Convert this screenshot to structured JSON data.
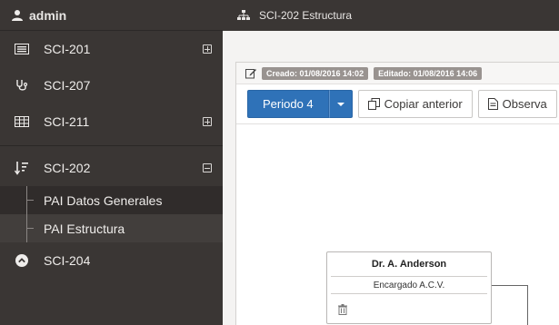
{
  "user": {
    "name": "admin"
  },
  "sidebar": {
    "items": [
      {
        "label": "SCI-201",
        "icon": "list-box-icon",
        "toggle": "plus"
      },
      {
        "label": "SCI-207",
        "icon": "stethoscope-icon",
        "toggle": "none"
      },
      {
        "label": "SCI-211",
        "icon": "table-icon",
        "toggle": "plus"
      },
      {
        "label": "SCI-202",
        "icon": "sort-down-icon",
        "toggle": "minus",
        "children": [
          {
            "label": "PAI Datos Generales",
            "active": false
          },
          {
            "label": "PAI Estructura",
            "active": true
          }
        ]
      },
      {
        "label": "SCI-204",
        "icon": "chevron-circle-up-icon",
        "toggle": "none"
      }
    ]
  },
  "topbar": {
    "title": "SCI-202 Estructura",
    "icon": "sitemap-icon"
  },
  "panel": {
    "edit_icon": "edit-icon",
    "created": "Creado: 01/08/2016 14:02",
    "edited": "Editado: 01/08/2016 14:06"
  },
  "toolbar": {
    "periodo_label": "Periodo 4",
    "copy_label": "Copiar anterior",
    "observ_label": "Observa"
  },
  "org": {
    "name": "Dr. A. Anderson",
    "role": "Encargado A.C.V."
  },
  "colors": {
    "sidebar_bg": "#3a3634",
    "primary": "#2f72b8",
    "badge": "#999390"
  }
}
